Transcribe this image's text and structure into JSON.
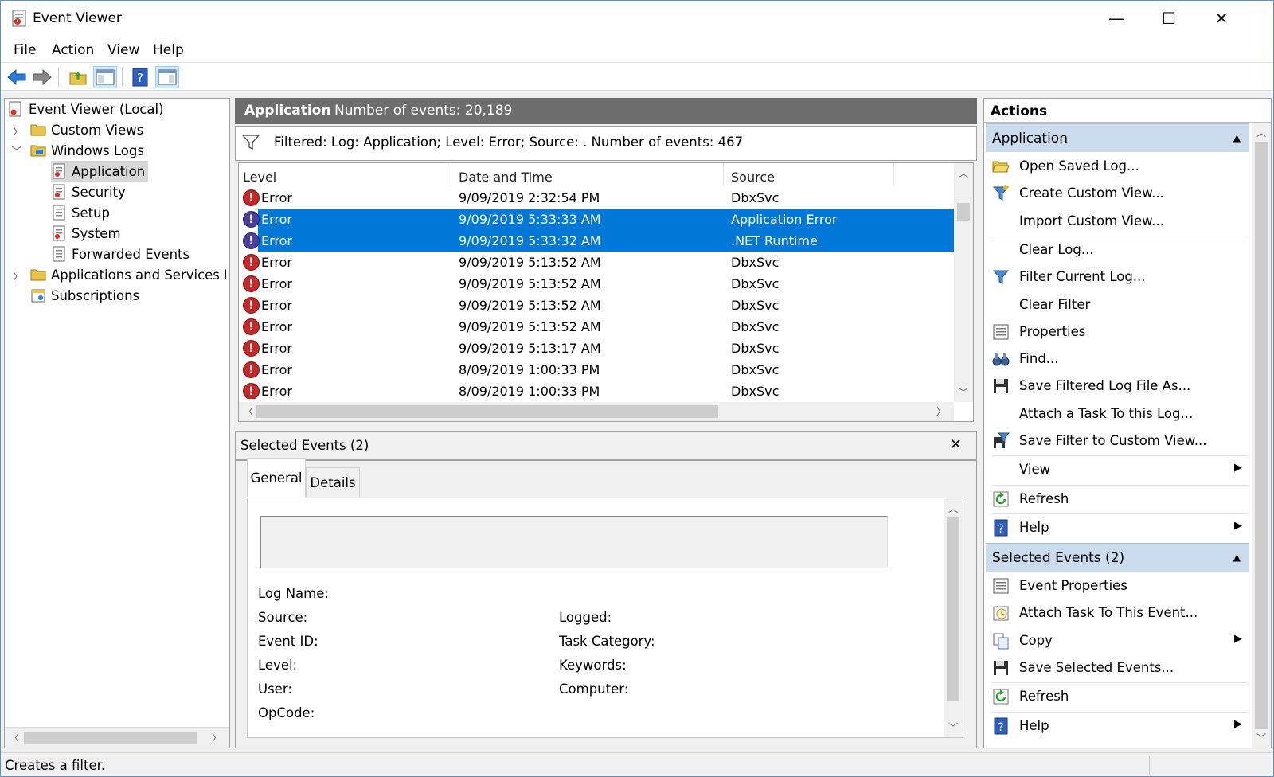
{
  "window": {
    "title": "Event Viewer",
    "minimize": "—",
    "maximize": "☐",
    "close": "✕"
  },
  "menu": [
    "File",
    "Action",
    "View",
    "Help"
  ],
  "tree": {
    "root": "Event Viewer (Local)",
    "custom_views": "Custom Views",
    "windows_logs": "Windows Logs",
    "application": "Application",
    "security": "Security",
    "setup": "Setup",
    "system": "System",
    "forwarded": "Forwarded Events",
    "app_services": "Applications and Services Logs",
    "subscriptions": "Subscriptions"
  },
  "center": {
    "log_name": "Application",
    "event_count": "Number of events: 20,189",
    "filter_text": "Filtered: Log: Application; Level: Error; Source: . Number of events: 467"
  },
  "grid": {
    "columns": [
      "Level",
      "Date and Time",
      "Source"
    ],
    "rows": [
      {
        "level": "Error",
        "date": "9/09/2019 2:32:54 PM",
        "source": "DbxSvc",
        "selected": false
      },
      {
        "level": "Error",
        "date": "9/09/2019 5:33:33 AM",
        "source": "Application Error",
        "selected": true
      },
      {
        "level": "Error",
        "date": "9/09/2019 5:33:32 AM",
        "source": ".NET Runtime",
        "selected": true
      },
      {
        "level": "Error",
        "date": "9/09/2019 5:13:52 AM",
        "source": "DbxSvc",
        "selected": false
      },
      {
        "level": "Error",
        "date": "9/09/2019 5:13:52 AM",
        "source": "DbxSvc",
        "selected": false
      },
      {
        "level": "Error",
        "date": "9/09/2019 5:13:52 AM",
        "source": "DbxSvc",
        "selected": false
      },
      {
        "level": "Error",
        "date": "9/09/2019 5:13:52 AM",
        "source": "DbxSvc",
        "selected": false
      },
      {
        "level": "Error",
        "date": "9/09/2019 5:13:17 AM",
        "source": "DbxSvc",
        "selected": false
      },
      {
        "level": "Error",
        "date": "8/09/2019 1:00:33 PM",
        "source": "DbxSvc",
        "selected": false
      },
      {
        "level": "Error",
        "date": "8/09/2019 1:00:33 PM",
        "source": "DbxSvc",
        "selected": false
      }
    ]
  },
  "details": {
    "title": "Selected Events (2)",
    "close": "✕",
    "tabs": [
      "General",
      "Details"
    ],
    "fields_left": [
      "Log Name:",
      "Source:",
      "Event ID:",
      "Level:",
      "User:",
      "OpCode:"
    ],
    "fields_right": [
      "Logged:",
      "Task Category:",
      "Keywords:",
      "Computer:"
    ]
  },
  "actions": {
    "header": "Actions",
    "section1": "Application",
    "items1": [
      {
        "label": "Open Saved Log...",
        "icon": "folder-open-icon"
      },
      {
        "label": "Create Custom View...",
        "icon": "funnel-star-icon"
      },
      {
        "label": "Import Custom View...",
        "icon": ""
      },
      {
        "label": "Clear Log...",
        "icon": ""
      },
      {
        "label": "Filter Current Log...",
        "icon": "funnel-icon"
      },
      {
        "label": "Clear Filter",
        "icon": ""
      },
      {
        "label": "Properties",
        "icon": "properties-icon"
      },
      {
        "label": "Find...",
        "icon": "binoculars-icon"
      },
      {
        "label": "Save Filtered Log File As...",
        "icon": "floppy-icon"
      },
      {
        "label": "Attach a Task To this Log...",
        "icon": ""
      },
      {
        "label": "Save Filter to Custom View...",
        "icon": "save-filter-icon"
      },
      {
        "label": "View",
        "icon": ""
      },
      {
        "label": "Refresh",
        "icon": "refresh-icon"
      },
      {
        "label": "Help",
        "icon": "help-icon"
      }
    ],
    "section2": "Selected Events (2)",
    "items2": [
      {
        "label": "Event Properties",
        "icon": "properties-icon"
      },
      {
        "label": "Attach Task To This Event...",
        "icon": "task-icon"
      },
      {
        "label": "Copy",
        "icon": "copy-icon"
      },
      {
        "label": "Save Selected Events...",
        "icon": "floppy-icon"
      },
      {
        "label": "Refresh",
        "icon": "refresh-icon"
      },
      {
        "label": "Help",
        "icon": "help-icon"
      }
    ]
  },
  "status": "Creates a filter."
}
